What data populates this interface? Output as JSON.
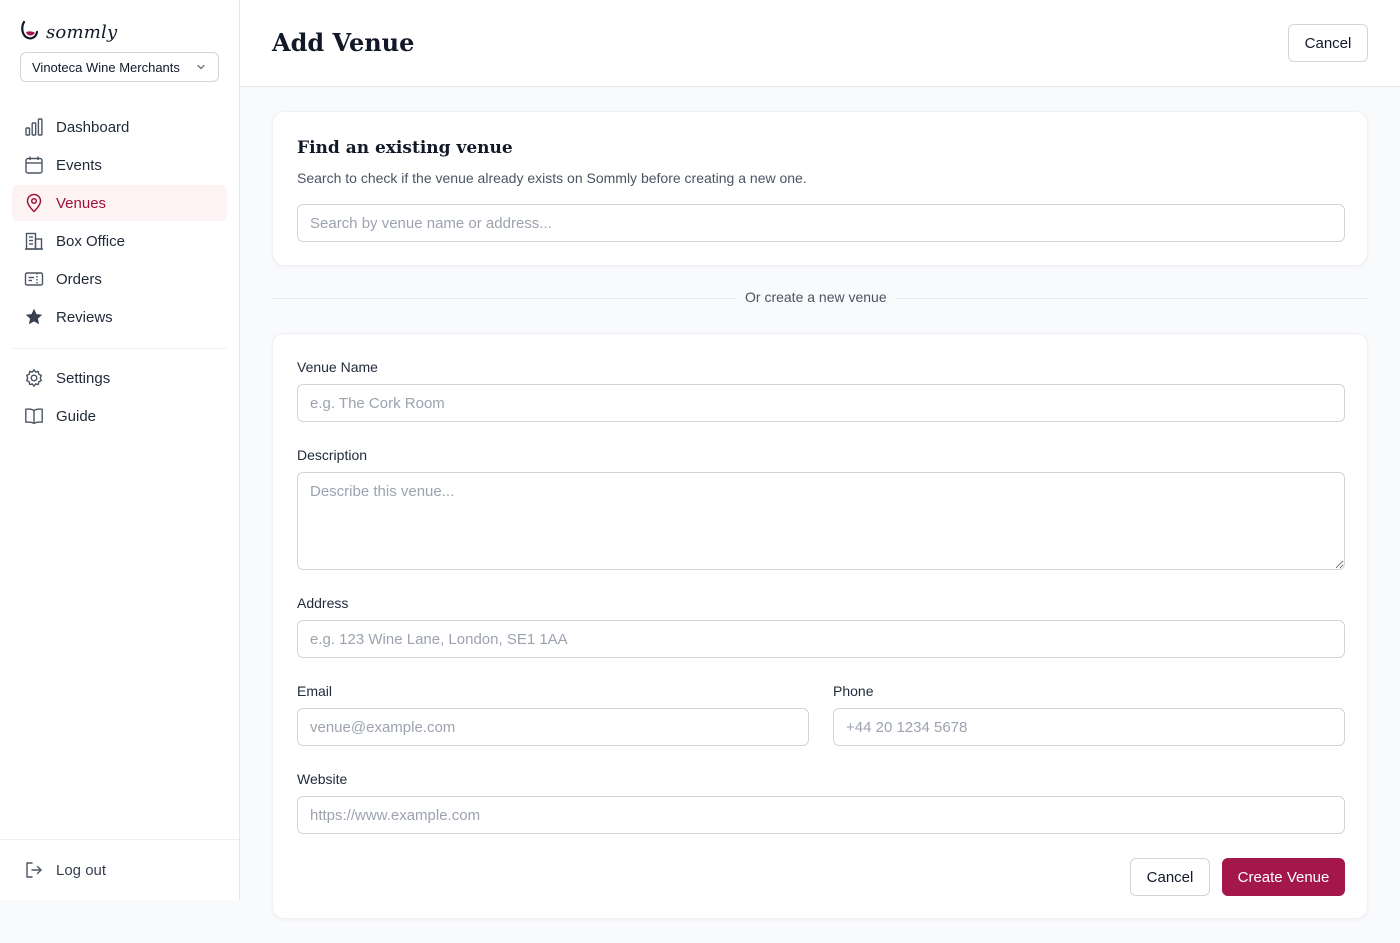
{
  "brand": {
    "name": "sommly",
    "accent": "#a3174a"
  },
  "org_selector": {
    "value": "Vinoteca Wine Merchants"
  },
  "nav": {
    "items": [
      {
        "label": "Dashboard",
        "icon": "bar-chart-icon"
      },
      {
        "label": "Events",
        "icon": "calendar-icon"
      },
      {
        "label": "Venues",
        "icon": "map-pin-icon",
        "active": true
      },
      {
        "label": "Box Office",
        "icon": "building-icon"
      },
      {
        "label": "Orders",
        "icon": "ticket-icon"
      },
      {
        "label": "Reviews",
        "icon": "star-icon"
      }
    ],
    "secondary": [
      {
        "label": "Settings",
        "icon": "gear-icon"
      },
      {
        "label": "Guide",
        "icon": "book-icon"
      }
    ],
    "logout": {
      "label": "Log out",
      "icon": "logout-icon"
    }
  },
  "header": {
    "title": "Add Venue",
    "cancel_label": "Cancel"
  },
  "search_card": {
    "title": "Find an existing venue",
    "subtitle": "Search to check if the venue already exists on Sommly before creating a new one.",
    "placeholder": "Search by venue name or address..."
  },
  "separator_label": "Or create a new venue",
  "form": {
    "venue_name": {
      "label": "Venue Name",
      "placeholder": "e.g. The Cork Room"
    },
    "description": {
      "label": "Description",
      "placeholder": "Describe this venue..."
    },
    "address": {
      "label": "Address",
      "placeholder": "e.g. 123 Wine Lane, London, SE1 1AA"
    },
    "email": {
      "label": "Email",
      "placeholder": "venue@example.com"
    },
    "phone": {
      "label": "Phone",
      "placeholder": "+44 20 1234 5678"
    },
    "website": {
      "label": "Website",
      "placeholder": "https://www.example.com"
    },
    "cancel_label": "Cancel",
    "submit_label": "Create Venue"
  }
}
